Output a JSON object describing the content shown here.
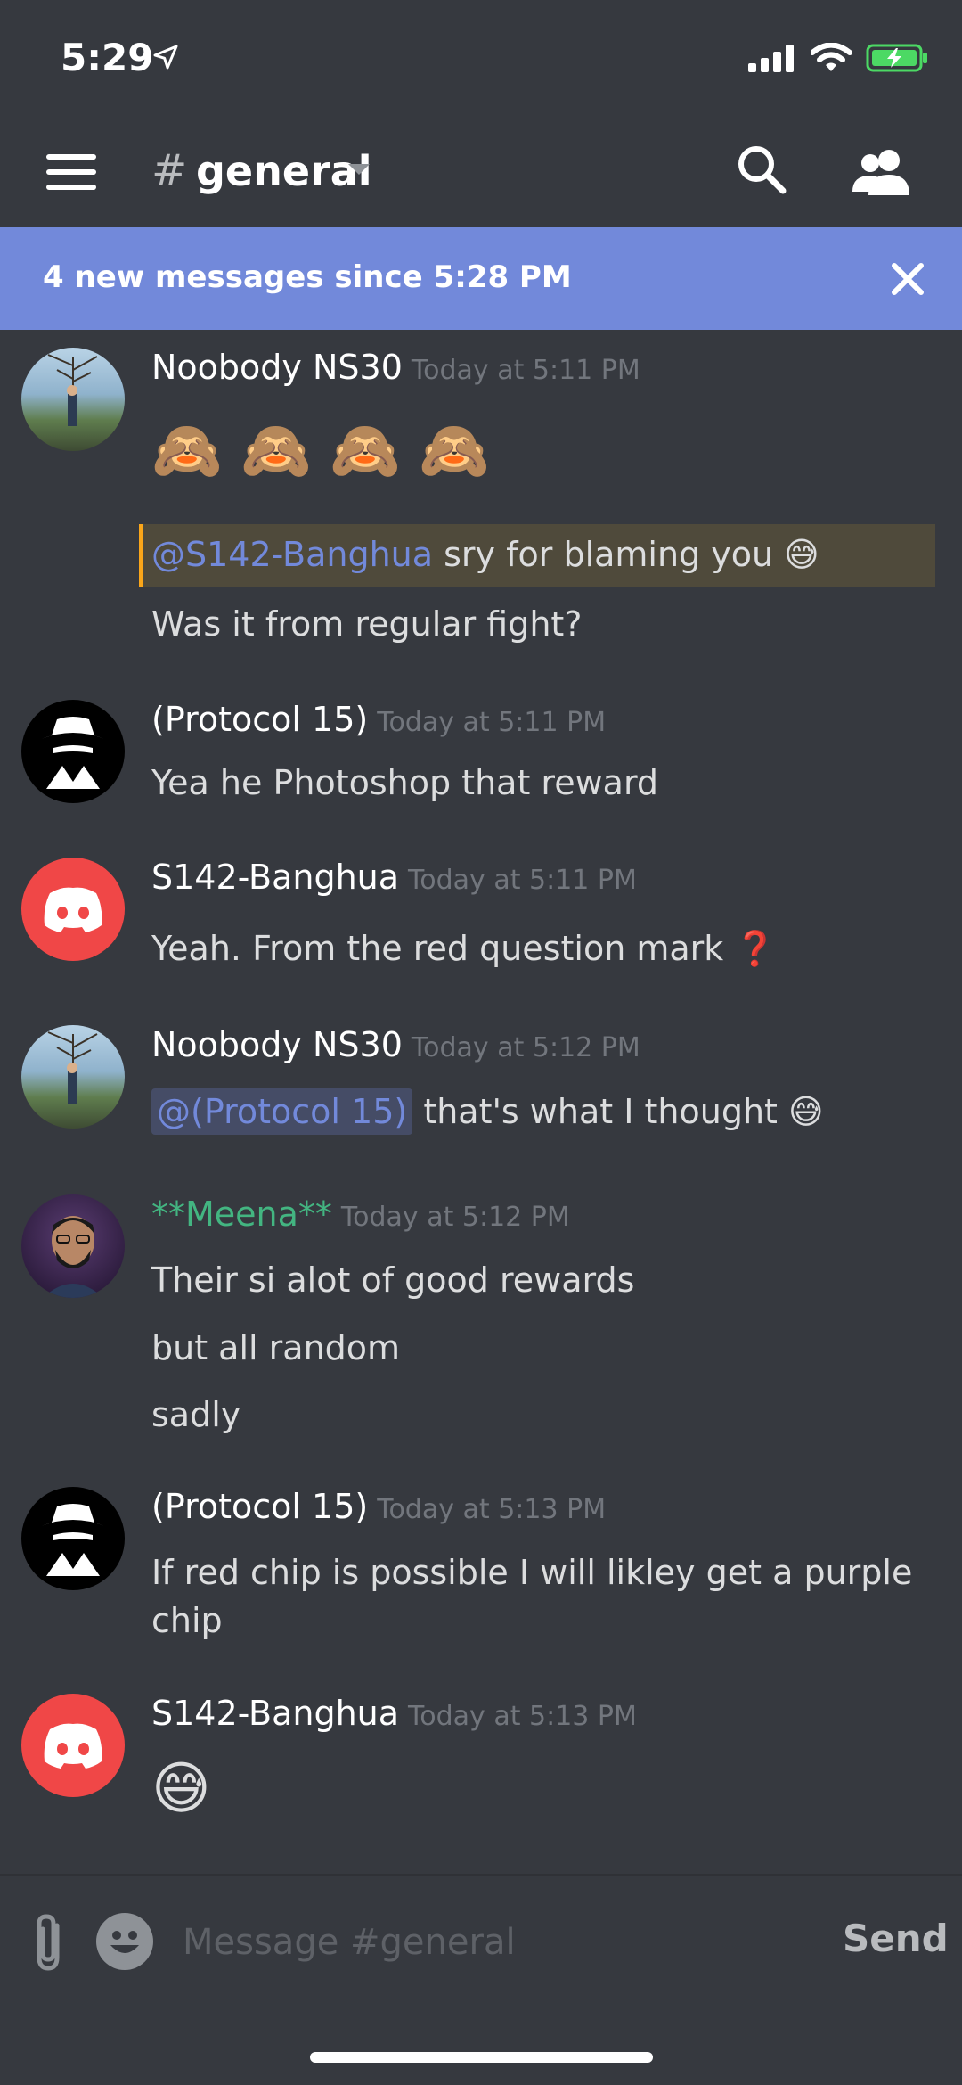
{
  "status_bar": {
    "time": "5:29"
  },
  "header": {
    "hash": "#",
    "channel": "general"
  },
  "banner": {
    "text": "4 new messages since 5:28 PM"
  },
  "colors": {
    "accent": "#7289da",
    "background": "#36393f",
    "highlight": "#faa61a",
    "green_name": "#43b581",
    "discord_red": "#f04747"
  },
  "messages": [
    {
      "author": "Noobody NS30",
      "time": "Today at 5:11 PM",
      "mention": "@S142-Banghua",
      "highlighted": "sry for blaming you 😅",
      "follow": "Was it from regular fight?",
      "emojis": "🙈 🙈 🙈 🙈"
    },
    {
      "author": "(Protocol 15)",
      "time": "Today at 5:11 PM",
      "line1": "Yea he Photoshop that reward"
    },
    {
      "author": "S142-Banghua",
      "time": "Today at 5:11 PM",
      "line1": "Yeah. From the red question mark",
      "emoji": "❓"
    },
    {
      "author": "Noobody NS30",
      "time": "Today at 5:12 PM",
      "mention": "@(Protocol 15)",
      "line1": "that's what I thought 😅"
    },
    {
      "author": "**Meena**",
      "time": "Today at 5:12 PM",
      "line1": "Their si alot of good rewards",
      "line2": "but all random",
      "line3": "sadly"
    },
    {
      "author": "(Protocol 15)",
      "time": "Today at 5:13 PM",
      "line1": "If red chip is possible I will likley get a purple",
      "line2": "chip"
    },
    {
      "author": "S142-Banghua",
      "time": "Today at 5:13 PM",
      "emoji": "😅"
    }
  ],
  "composer": {
    "placeholder": "Message #general",
    "send": "Send"
  }
}
